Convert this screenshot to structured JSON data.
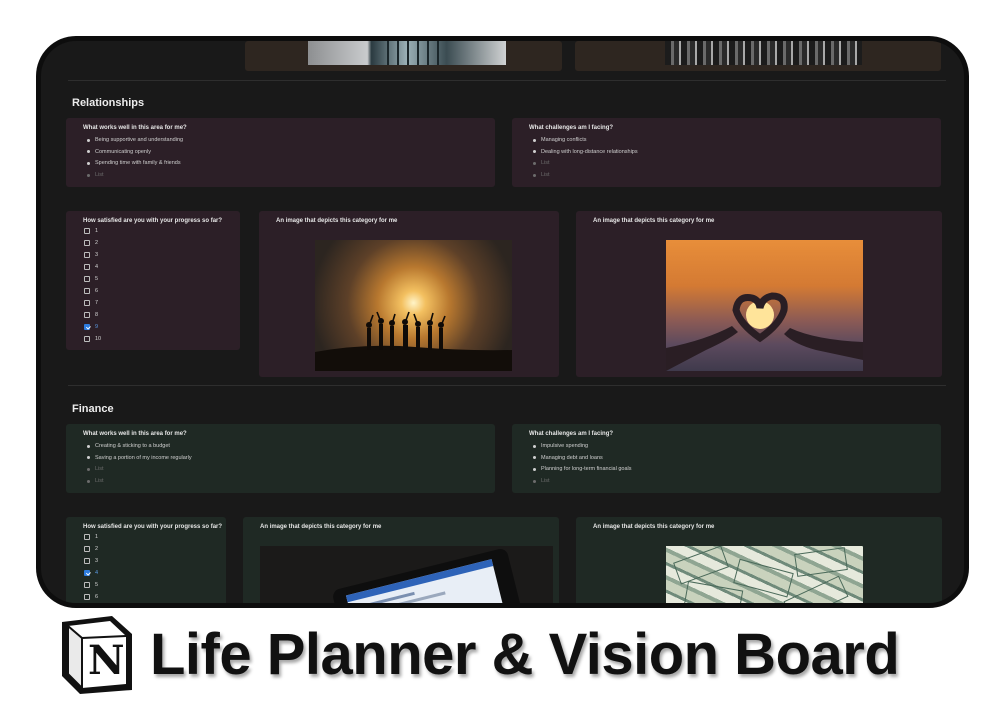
{
  "relationships": {
    "title": "Relationships",
    "works_heading": "What works well in this area for me?",
    "works_items": [
      "Being supportive and understanding",
      "Communicating openly",
      "Spending time with family & friends",
      "List"
    ],
    "challenges_heading": "What challenges am I facing?",
    "challenges_items": [
      "Managing conflicts",
      "Dealing with long-distance relationships",
      "List",
      "List"
    ],
    "satisfaction_heading": "How satisfied are you with your progress so far?",
    "satisfaction_options": [
      "1",
      "2",
      "3",
      "4",
      "5",
      "6",
      "7",
      "8",
      "9",
      "10"
    ],
    "satisfaction_checked": "9",
    "image1_heading": "An image that depicts this category for me",
    "image2_heading": "An image that depicts this category for me"
  },
  "finance": {
    "title": "Finance",
    "works_heading": "What works well in this area for me?",
    "works_items": [
      "Creating & sticking to a budget",
      "Saving a portion of my income regularly",
      "List",
      "List"
    ],
    "challenges_heading": "What challenges am I facing?",
    "challenges_items": [
      "Impulsive spending",
      "Managing debt and loans",
      "Planning for long-term financial goals",
      "List"
    ],
    "satisfaction_heading": "How satisfied are you with your progress so far?",
    "satisfaction_options": [
      "1",
      "2",
      "3",
      "4",
      "5",
      "6"
    ],
    "satisfaction_checked": "4",
    "image1_heading": "An image that depicts this category for me",
    "image2_heading": "An image that depicts this category for me"
  },
  "branding": {
    "logo_letter": "N",
    "title": "Life Planner & Vision Board"
  },
  "colors": {
    "relationships_card": "#2c1f27",
    "finance_card": "#1f2924",
    "checkbox_checked": "#2e7de0",
    "page_background": "#191919"
  }
}
